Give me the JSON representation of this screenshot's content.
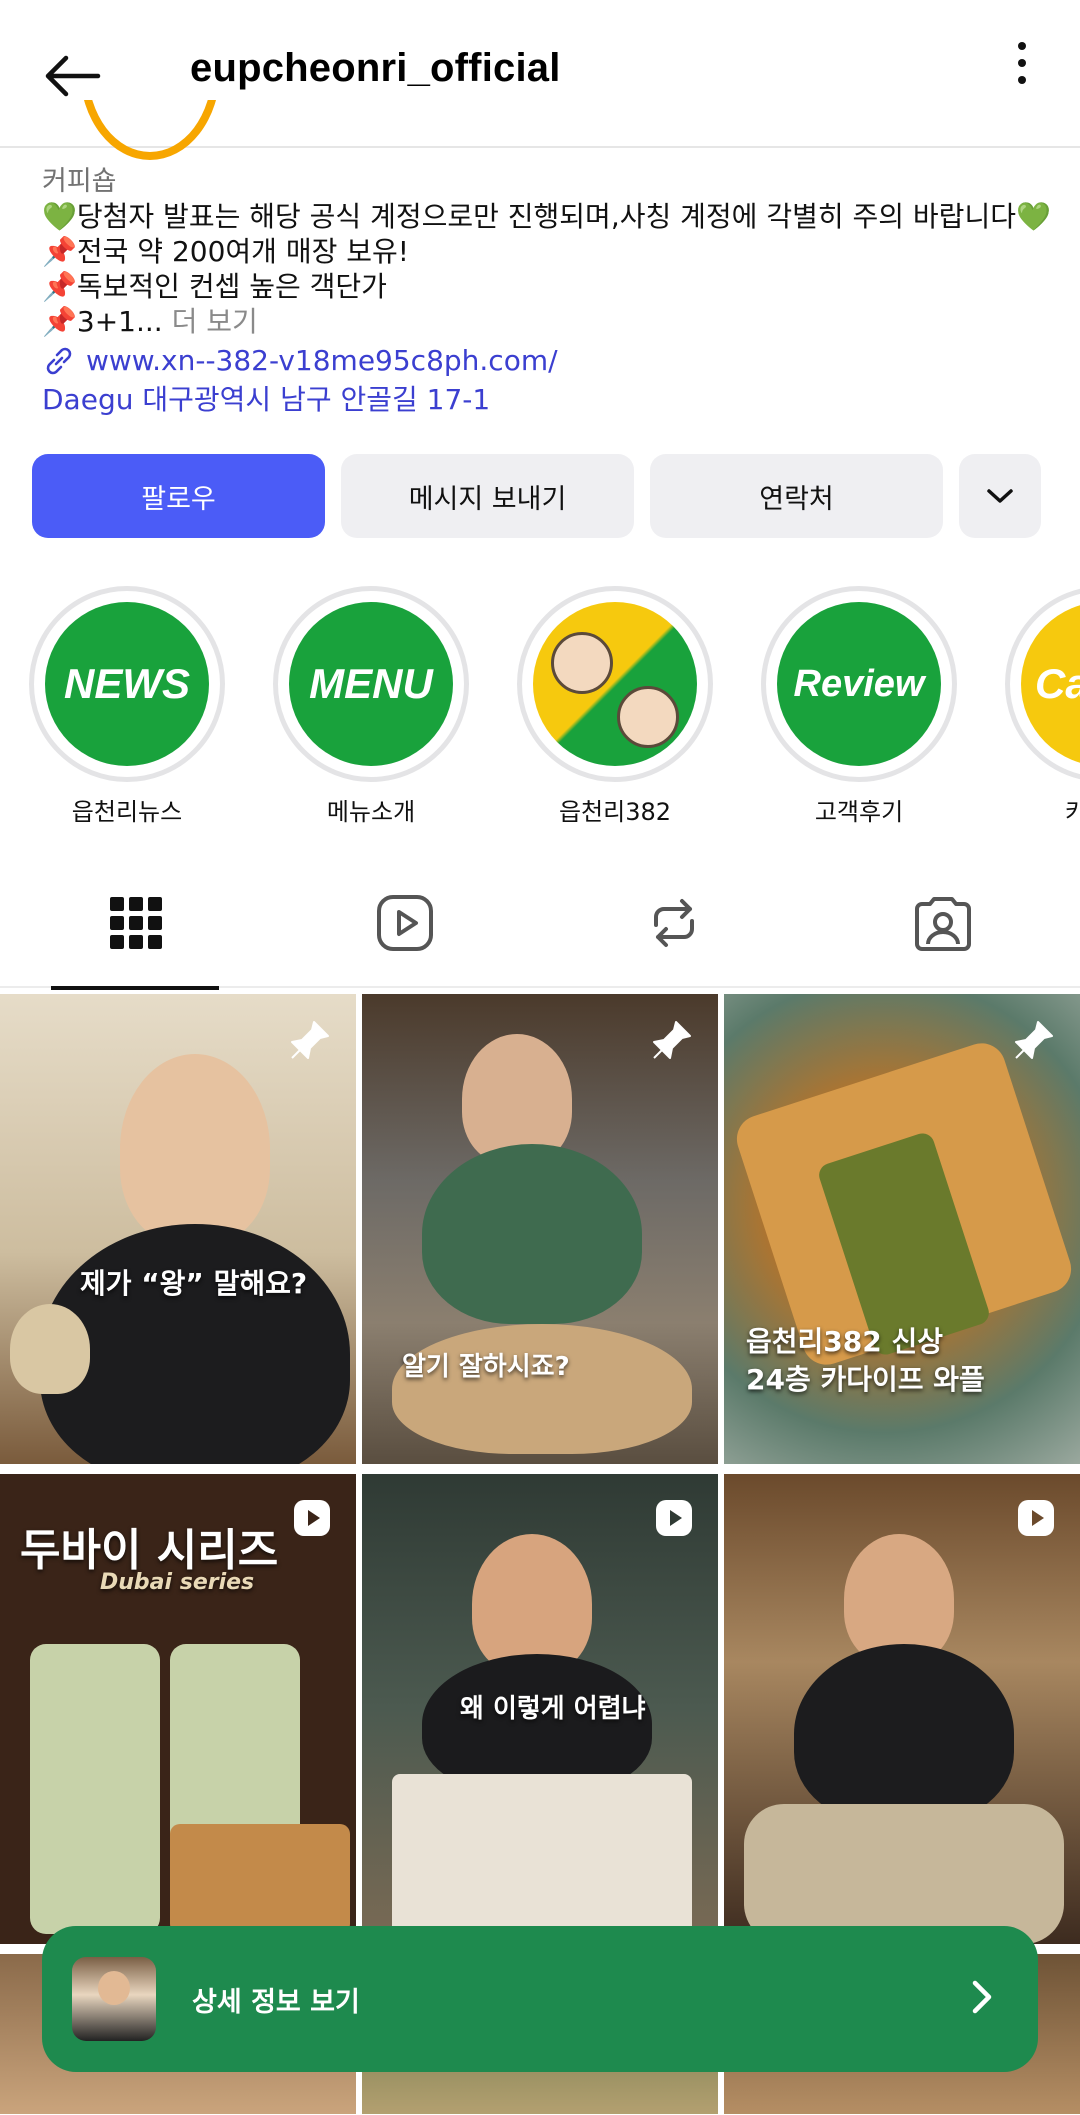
{
  "header": {
    "title": "eupcheonri_official"
  },
  "bio": {
    "category": "커피숍",
    "lines": [
      {
        "emoji": "💚",
        "text": "당첨자 발표는 해당 공식 계정으로만 진행되며,사칭 계정에 각별히 주의 바랍니다",
        "emoji_end": "💚"
      },
      {
        "emoji": "📌",
        "text": "전국 약 200여개 매장 보유!"
      },
      {
        "emoji": "📌",
        "text": "독보적인 컨셉 높은 객단가"
      },
      {
        "emoji": "📌",
        "text": "3+1...",
        "more": "더 보기"
      }
    ],
    "link": "www.xn--382-v18me95c8ph.com/",
    "address": "Daegu 대구광역시 남구 안골길 17-1"
  },
  "buttons": {
    "follow": "팔로우",
    "message": "메시지 보내기",
    "contact": "연락처"
  },
  "highlights": [
    {
      "label": "읍천리뉴스",
      "cover": "NEWS"
    },
    {
      "label": "메뉴소개",
      "cover": "MENU"
    },
    {
      "label": "읍천리382",
      "cover": ""
    },
    {
      "label": "고객후기",
      "cover": "Review"
    },
    {
      "label": "카",
      "cover": "Ca"
    }
  ],
  "grid": {
    "captions": [
      "제가 “왕” 말해요?",
      "알기 잘하시죠?",
      "읍천리382 신상",
      "24층 카다이프 와플",
      "두바이 시리즈",
      "Dubai series",
      "왜 이렇게 어렵냐"
    ]
  },
  "banner": {
    "label": "상세 정보 보기"
  },
  "colors": {
    "primary_button": "#4b5cf7",
    "highlight_green": "#19a23c",
    "banner_green": "#1e8a4e",
    "link_blue": "#3b3fd0"
  }
}
